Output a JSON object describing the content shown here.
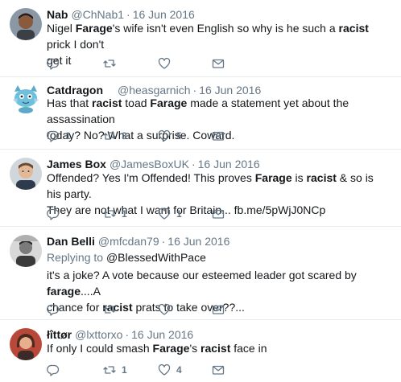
{
  "tweets": [
    {
      "name": "Nab",
      "handle": "@ChNab1",
      "date": "16 Jun 2016",
      "avatar": "avatar-dark-hair",
      "reply_to": null,
      "line1_parts": [
        "Nigel ",
        "Farage",
        "'s wife isn't even English so why is he such a ",
        "racist",
        " prick I don't"
      ],
      "line2_parts": [
        "get it"
      ],
      "replies": "",
      "retweets": "",
      "likes": ""
    },
    {
      "name": "Catdragon",
      "handle": "@heasgarnich",
      "date": "16 Jun 2016",
      "avatar": "avatar-cartoon-cat",
      "reply_to": null,
      "line1_parts": [
        "Has that ",
        "racist",
        " toad ",
        "Farage",
        " made a statement yet about the assassination"
      ],
      "line2_parts": [
        "today?  No?  What a surprise.  Coward."
      ],
      "replies": "1",
      "retweets": "3",
      "likes": "5"
    },
    {
      "name": "James Box",
      "handle": "@JamesBoxUK",
      "date": "16 Jun 2016",
      "avatar": "avatar-man",
      "reply_to": null,
      "line1_parts": [
        "Offended? Yes I'm Offended! This proves ",
        "Farage",
        " is ",
        "racist",
        " & so is his party."
      ],
      "line2_parts": [
        "They are not what I want for Britain... fb.me/5pWjJ0NCp"
      ],
      "replies": "",
      "retweets": "1",
      "likes": "1"
    },
    {
      "name": "Dan Belli",
      "handle": "@mfcdan79",
      "date": "16 Jun 2016",
      "avatar": "avatar-bw",
      "reply_to": {
        "prefix": "Replying to ",
        "mention": "@BlessedWithPace"
      },
      "line1_parts": [
        "it's a joke? A vote because our esteemed leader got scared by ",
        "farage",
        "....A"
      ],
      "line2_parts": [
        "chance for ",
        "racist",
        " prats to take over??..."
      ],
      "replies": "",
      "retweets": "",
      "likes": ""
    },
    {
      "name": "łîttør",
      "handle": "@lxttorxo",
      "date": "16 Jun 2016",
      "avatar": "avatar-woman",
      "reply_to": null,
      "line1_parts": [
        "If only I could smash ",
        "Farage",
        "'s ",
        "racist",
        " face in"
      ],
      "line2_parts": [],
      "replies": "",
      "retweets": "1",
      "likes": "4"
    }
  ],
  "dot_separator": "·",
  "icons": {
    "reply": "reply-icon",
    "retweet": "retweet-icon",
    "like": "heart-icon",
    "message": "envelope-icon"
  },
  "colors": {
    "text": "#14171a",
    "secondary": "#657786",
    "divider": "#e6ecf0"
  }
}
